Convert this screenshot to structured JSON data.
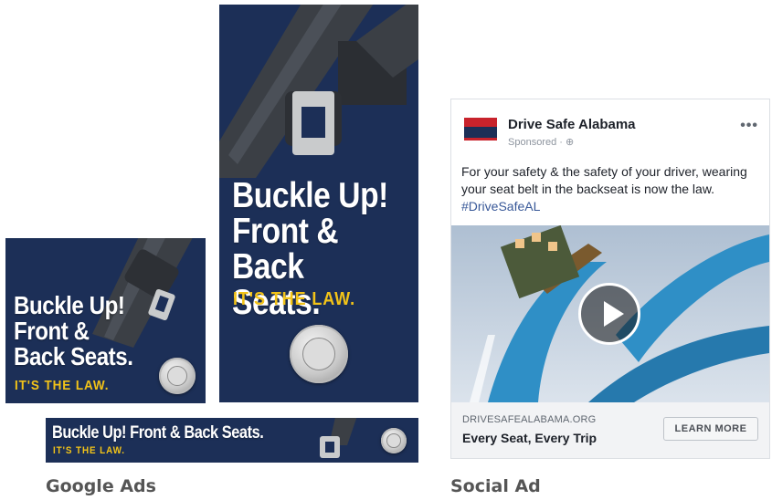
{
  "google_ads": {
    "caption": "Google Ads",
    "headline_lines": [
      "Buckle Up!",
      "Front &",
      "Back Seats."
    ],
    "headline_single": "Buckle Up! Front & Back Seats.",
    "tagline": "IT'S THE LAW.",
    "seal_icon": "alabama-state-seal-icon",
    "colors": {
      "background": "#1c2f57",
      "headline": "#ffffff",
      "tagline": "#f2c318"
    }
  },
  "social_ad": {
    "caption": "Social Ad",
    "page_name": "Drive Safe Alabama",
    "sponsored": "Sponsored · ⊕",
    "more_icon": "•••",
    "post_text": "For your safety & the safety of your driver, wearing your seat belt in the backseat is now the law. ",
    "hashtag": "#DriveSafeAL",
    "link_domain": "DRIVESAFEALABAMA.ORG",
    "link_headline": "Every Seat, Every Trip",
    "cta_label": "LEARN MORE",
    "play_icon": "play-icon",
    "colors": {
      "hashtag": "#385898",
      "footer_bg": "#f2f3f5"
    }
  }
}
